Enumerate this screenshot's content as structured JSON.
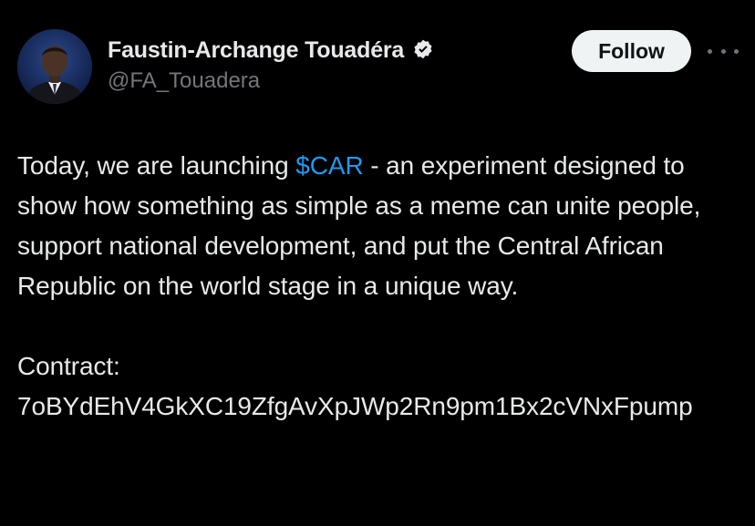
{
  "author": {
    "display_name": "Faustin-Archange Touadéra",
    "handle": "@FA_Touadera",
    "verified": true,
    "verified_icon": "verified-badge-icon",
    "avatar_icon": "profile-photo-avatar"
  },
  "actions": {
    "follow_label": "Follow",
    "more_icon": "more-options-icon"
  },
  "tweet": {
    "text_before_cashtag": "Today, we are launching ",
    "cashtag": "$CAR",
    "text_after_cashtag": " - an experiment designed to show how something as simple as a meme can unite people, support national development, and put the Central African Republic on the world stage in a unique way.",
    "contract_label": "Contract:",
    "contract_address": "7oBYdEhV4GkXC19ZfgAvXpJWp2Rn9pm1Bx2cVNxFpump"
  },
  "colors": {
    "background": "#000000",
    "text": "#e7e9ea",
    "secondary_text": "#71767b",
    "link": "#1d9bf0",
    "follow_button_bg": "#eff3f4",
    "follow_button_text": "#0f1419"
  }
}
